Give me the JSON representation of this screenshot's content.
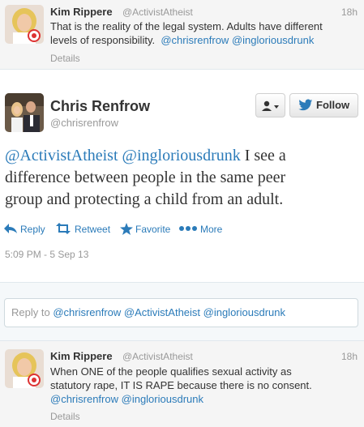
{
  "top_tweet": {
    "name": "Kim Rippere",
    "handle": "@ActivistAtheist",
    "time": "18h",
    "text_line1": "That is the reality of the legal system. Adults have different",
    "text_line2_plain": "levels of responsibility.",
    "mention1": "@chrisrenfrow",
    "mention2": "@ingloriousdrunk",
    "details": "Details"
  },
  "main_tweet": {
    "name": "Chris Renfrow",
    "handle": "@chrisrenfrow",
    "user_menu_icon": "user-dropdown-icon",
    "follow_label": "Follow",
    "mention1": "@ActivistAtheist",
    "mention2": "@ingloriousdrunk",
    "text_rest_line1": " I see a",
    "text_line2": "difference between people in the same peer",
    "text_line3": "group and protecting a child from an adult.",
    "actions": {
      "reply": "Reply",
      "retweet": "Retweet",
      "favorite": "Favorite",
      "more": "More"
    },
    "timestamp": "5:09 PM - 5 Sep 13",
    "reply_prefix": "Reply to ",
    "reply_mentions": "@chrisrenfrow @ActivistAtheist @ingloriousdrunk"
  },
  "bottom_tweet": {
    "name": "Kim Rippere",
    "handle": "@ActivistAtheist",
    "time": "18h",
    "text_line1": "When ONE of the people qualifies sexual activity as",
    "text_line2": "statutory rape, IT IS RAPE because there is no consent.",
    "mention1": "@chrisrenfrow",
    "mention2": "@ingloriousdrunk",
    "details": "Details"
  },
  "colors": {
    "link": "#2b7bb9",
    "muted": "#999999",
    "text": "#333333"
  }
}
